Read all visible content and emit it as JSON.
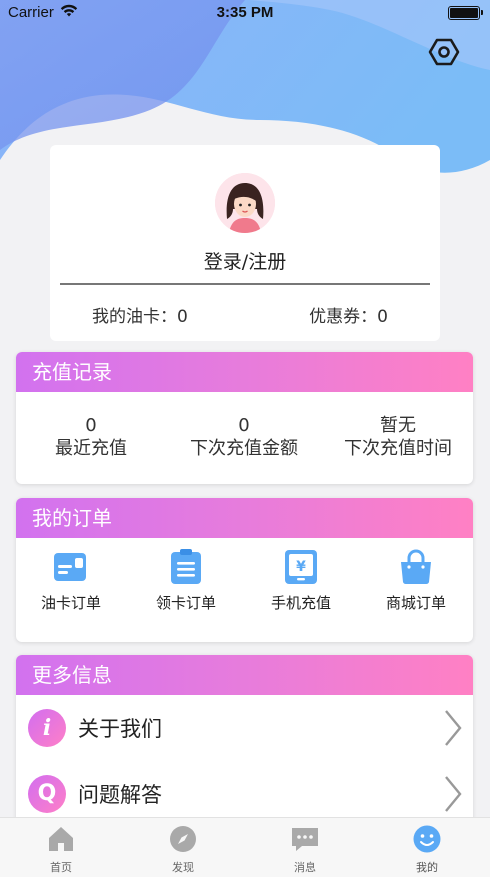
{
  "status_bar": {
    "carrier": "Carrier",
    "time": "3:35 PM"
  },
  "profile": {
    "login_label": "登录/注册",
    "oil_card_label": "我的油卡：0",
    "coupon_label": "优惠券：0"
  },
  "recharge": {
    "title": "充值记录",
    "columns": [
      {
        "value": "0",
        "label": "最近充值"
      },
      {
        "value": "0",
        "label": "下次充值金额"
      },
      {
        "value": "暂无",
        "label": "下次充值时间"
      }
    ]
  },
  "orders": {
    "title": "我的订单",
    "items": [
      {
        "label": "油卡订单",
        "icon": "card-icon"
      },
      {
        "label": "领卡订单",
        "icon": "clipboard-icon"
      },
      {
        "label": "手机充值",
        "icon": "phone-yen-icon"
      },
      {
        "label": "商城订单",
        "icon": "shopping-bag-icon"
      }
    ]
  },
  "more": {
    "title": "更多信息",
    "items": [
      {
        "label": "关于我们",
        "badge": "i"
      },
      {
        "label": "问题解答",
        "badge": "Q"
      }
    ]
  },
  "tabbar": {
    "items": [
      {
        "label": "首页",
        "icon": "home-icon"
      },
      {
        "label": "发现",
        "icon": "compass-icon"
      },
      {
        "label": "消息",
        "icon": "message-icon"
      },
      {
        "label": "我的",
        "icon": "smiley-icon",
        "active": true
      }
    ]
  },
  "colors": {
    "accent_start": "#d272ef",
    "accent_end": "#ff80c4",
    "icon_blue": "#5aa9f5",
    "header_bg": "#8ab4f6"
  }
}
